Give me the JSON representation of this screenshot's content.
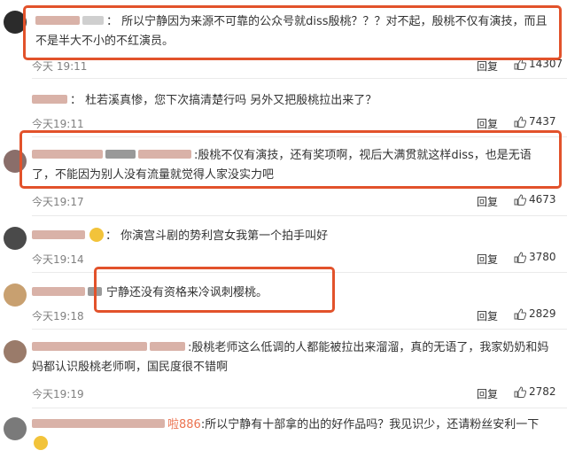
{
  "comments": [
    {
      "name": "···",
      "text": "： 所以宁静因为来源不可靠的公众号就diss殷桃？？？对不起，殷桃不仅有演技，而且不是半大不小的不红演员。",
      "time": "今天 19:11",
      "reply": "回复",
      "likes": "14307"
    },
    {
      "name": "···",
      "text": "： 杜若溪真惨，您下次搞清楚行吗 另外又把殷桃拉出来了？",
      "time": "今天19:11",
      "reply": "回复",
      "likes": "7437"
    },
    {
      "name": "886",
      "text": ":殷桃不仅有演技，还有奖项啊，视后大满贯就这样diss，也是无语了，不能因为别人没有流量就觉得人家没实力吧",
      "time": "今天19:17",
      "reply": "回复",
      "likes": "4673"
    },
    {
      "name": "···",
      "text": "： 你演宫斗剧的势利宫女我第一个拍手叫好",
      "time": "今天19:14",
      "reply": "回复",
      "likes": "3780"
    },
    {
      "name": "···",
      "text": "宁静还没有资格来冷讽刺樱桃。",
      "time": "今天19:18",
      "reply": "回复",
      "likes": "2829"
    },
    {
      "name": "886",
      "text": ":殷桃老师这么低调的人都能被拉出来溜溜，真的无语了，我家奶奶和妈妈都认识殷桃老师啊，国民度很不错啊",
      "time": "今天19:19",
      "reply": "回复",
      "likes": "2782"
    },
    {
      "name": "啦886",
      "text": ":所以宁静有十部拿的出的好作品吗？我见识少，还请粉丝安利一下"
    }
  ],
  "colors": {
    "highlight": "#e2522b",
    "username": "#eb7350",
    "time": "#808080"
  }
}
